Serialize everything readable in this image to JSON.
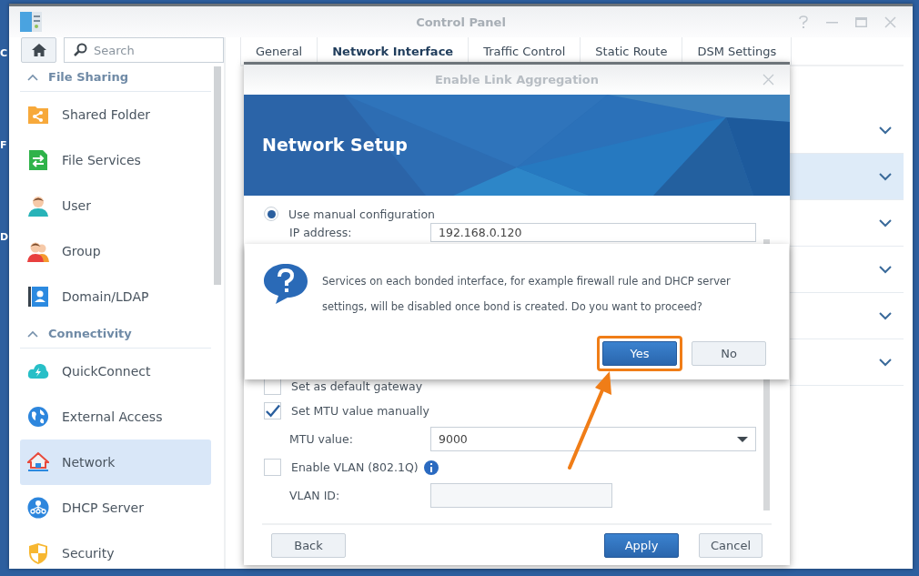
{
  "desktop": {
    "labels": [
      "C",
      "F",
      "D"
    ]
  },
  "window": {
    "title": "Control Panel"
  },
  "sidebar": {
    "search": {
      "placeholder": "Search"
    },
    "sections": [
      {
        "title": "File Sharing",
        "expanded": true,
        "items": [
          {
            "label": "Shared Folder",
            "selected": false
          },
          {
            "label": "File Services",
            "selected": false
          },
          {
            "label": "User",
            "selected": false
          },
          {
            "label": "Group",
            "selected": false
          },
          {
            "label": "Domain/LDAP",
            "selected": false
          }
        ]
      },
      {
        "title": "Connectivity",
        "expanded": true,
        "items": [
          {
            "label": "QuickConnect",
            "selected": false
          },
          {
            "label": "External Access",
            "selected": false
          },
          {
            "label": "Network",
            "selected": true
          },
          {
            "label": "DHCP Server",
            "selected": false
          },
          {
            "label": "Security",
            "selected": false
          }
        ]
      }
    ]
  },
  "tabs": [
    {
      "label": "General",
      "selected": false
    },
    {
      "label": "Network Interface",
      "selected": true
    },
    {
      "label": "Traffic Control",
      "selected": false
    },
    {
      "label": "Static Route",
      "selected": false
    },
    {
      "label": "DSM Settings",
      "selected": false
    }
  ],
  "panel_rows": [
    {
      "selected": false
    },
    {
      "selected": true
    },
    {
      "selected": false
    },
    {
      "selected": false
    },
    {
      "selected": false
    },
    {
      "selected": false
    }
  ],
  "dialog": {
    "title": "Enable Link Aggregation",
    "banner": "Network Setup",
    "form": [
      {
        "kind": "radio",
        "label": "Use manual configuration",
        "selected": true
      },
      {
        "kind": "field",
        "label": "IP address:",
        "value": "192.168.0.120",
        "disabled": false
      },
      {
        "kind": "checkbox",
        "label": "Set as default gateway",
        "checked": false
      },
      {
        "kind": "checkbox",
        "label": "Set MTU value manually",
        "checked": true
      },
      {
        "kind": "select",
        "label": "MTU value:",
        "value": "9000"
      },
      {
        "kind": "checkbox",
        "label": "Enable VLAN (802.1Q)",
        "checked": false,
        "info": true
      },
      {
        "kind": "field",
        "label": "VLAN ID:",
        "disabled": true
      }
    ],
    "buttons": [
      {
        "label": "Back",
        "primary": false
      },
      {
        "label": "Apply",
        "primary": true
      },
      {
        "label": "Cancel",
        "primary": false
      }
    ]
  },
  "confirm": {
    "message": "Services on each bonded interface, for example firewall rule and DHCP server settings, will be disabled once bond is created. Do you want to proceed?",
    "buttons": [
      {
        "label": "Yes",
        "primary": true,
        "highlighted": true
      },
      {
        "label": "No",
        "primary": false,
        "highlighted": false
      }
    ]
  }
}
